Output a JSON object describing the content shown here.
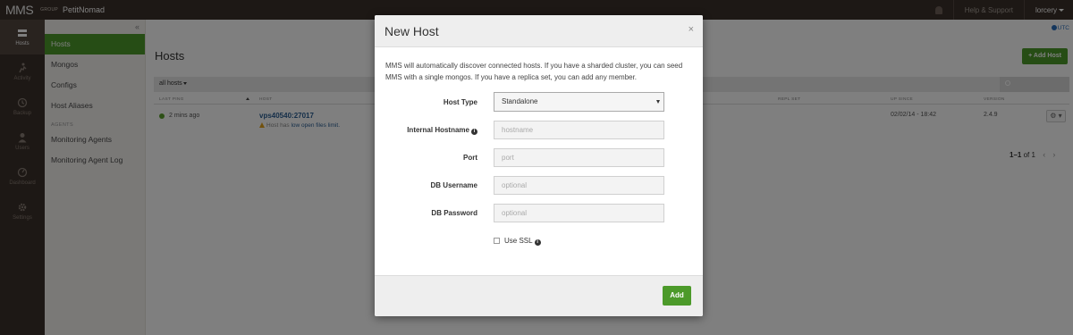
{
  "topbar": {
    "logo": "MMS",
    "group_label": "GROUP",
    "group_name": "PetitNomad",
    "help_link": "Help & Support",
    "user": "lorcery"
  },
  "rail": [
    {
      "label": "Hosts",
      "icon": "server-icon"
    },
    {
      "label": "Activity",
      "icon": "activity-icon"
    },
    {
      "label": "Backup",
      "icon": "backup-icon"
    },
    {
      "label": "Users",
      "icon": "user-icon"
    },
    {
      "label": "Dashboard",
      "icon": "dashboard-icon"
    },
    {
      "label": "Settings",
      "icon": "settings-icon"
    }
  ],
  "subnav": {
    "collapse": "«",
    "items": [
      "Hosts",
      "Mongos",
      "Configs",
      "Host Aliases"
    ],
    "section_label": "AGENTS",
    "agent_items": [
      "Monitoring Agents",
      "Monitoring Agent Log"
    ]
  },
  "main": {
    "utc": "UTC",
    "title": "Hosts",
    "add_host": "+ Add Host",
    "filter": "all hosts",
    "columns": {
      "last_ping": "LAST PING",
      "host": "HOST",
      "repl_set": "REPL SET",
      "up_since": "UP SINCE",
      "version": "VERSION"
    },
    "row": {
      "last_ping": "2 mins ago",
      "host": "vps40540:27017",
      "warning_prefix": "Host has",
      "warning_link": "low open files limit.",
      "up_since": "02/02/14 - 18:42",
      "version": "2.4.9",
      "action": "⚙ ▾"
    },
    "pager": {
      "range": "1–1",
      "of": "of",
      "total": "1"
    }
  },
  "modal": {
    "title": "New Host",
    "close": "×",
    "description": "MMS will automatically discover connected hosts. If you have a sharded cluster, you can seed MMS with a single mongos. If you have a replica set, you can add any member.",
    "fields": {
      "host_type": {
        "label": "Host Type",
        "value": "Standalone"
      },
      "internal_hostname": {
        "label": "Internal Hostname",
        "placeholder": "hostname"
      },
      "port": {
        "label": "Port",
        "placeholder": "port"
      },
      "db_username": {
        "label": "DB Username",
        "placeholder": "optional"
      },
      "db_password": {
        "label": "DB Password",
        "placeholder": "optional"
      }
    },
    "use_ssl": "Use SSL",
    "info_glyph": "i",
    "submit": "Add"
  },
  "colors": {
    "topbar": "#3b302a",
    "accent_green": "#4c9a2a",
    "link_blue": "#2a5e93",
    "warning": "#e3a21a"
  }
}
